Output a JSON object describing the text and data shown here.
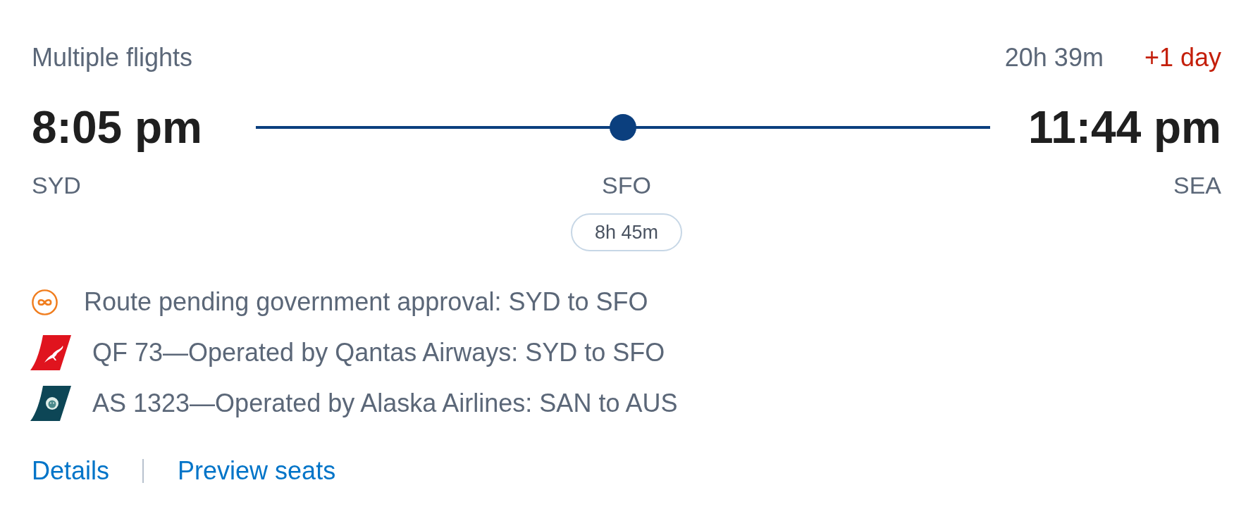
{
  "header": {
    "label": "Multiple flights",
    "duration": "20h 39m",
    "day_offset": "+1 day"
  },
  "departure": {
    "time": "8:05 pm",
    "airport": "SYD"
  },
  "stop": {
    "airport": "SFO",
    "layover": "8h 45m"
  },
  "arrival": {
    "time": "11:44 pm",
    "airport": "SEA"
  },
  "segments": [
    {
      "kind": "notice",
      "color": "#f07d1e",
      "text": "Route pending government approval: SYD to SFO"
    },
    {
      "kind": "flight",
      "color": "#e0141e",
      "text": "QF 73—Operated by Qantas Airways: SYD to SFO"
    },
    {
      "kind": "flight",
      "color": "#0d4656",
      "text": "AS 1323—Operated by Alaska Airlines: SAN to AUS"
    }
  ],
  "links": [
    "Details",
    "Preview seats"
  ]
}
